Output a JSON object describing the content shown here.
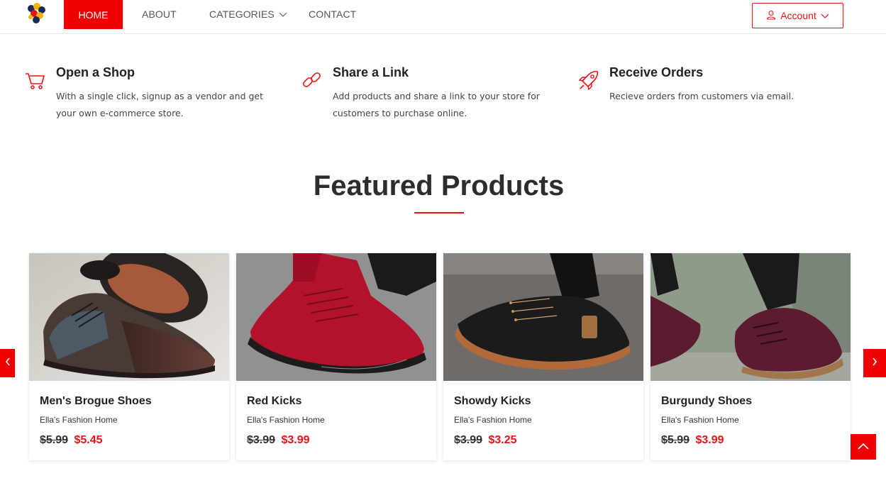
{
  "nav": {
    "home": "HOME",
    "about": "ABOUT",
    "categories": "CATEGORIES",
    "contact": "CONTACT",
    "account": "Account"
  },
  "features": [
    {
      "icon": "cart-icon",
      "title": "Open a Shop",
      "text": "With a single click, signup as a vendor and get your own e-commerce store."
    },
    {
      "icon": "link-icon",
      "title": "Share a Link",
      "text": "Add products and share a link to your store for customers to purchase online."
    },
    {
      "icon": "rocket-icon",
      "title": "Receive Orders",
      "text": "Recieve orders from customers via email."
    }
  ],
  "featured": {
    "title": "Featured Products"
  },
  "products": [
    {
      "name": "Men's Brogue Shoes",
      "vendor": "Ella's Fashion Home",
      "old_price": "$5.99",
      "price": "$5.45"
    },
    {
      "name": "Red Kicks",
      "vendor": "Ella's Fashion Home",
      "old_price": "$3.99",
      "price": "$3.99"
    },
    {
      "name": "Showdy Kicks",
      "vendor": "Ella's Fashion Home",
      "old_price": "$3.99",
      "price": "$3.25"
    },
    {
      "name": "Burgundy Shoes",
      "vendor": "Ella's Fashion Home",
      "old_price": "$5.99",
      "price": "$3.99"
    }
  ],
  "colors": {
    "accent": "#ee0000"
  }
}
